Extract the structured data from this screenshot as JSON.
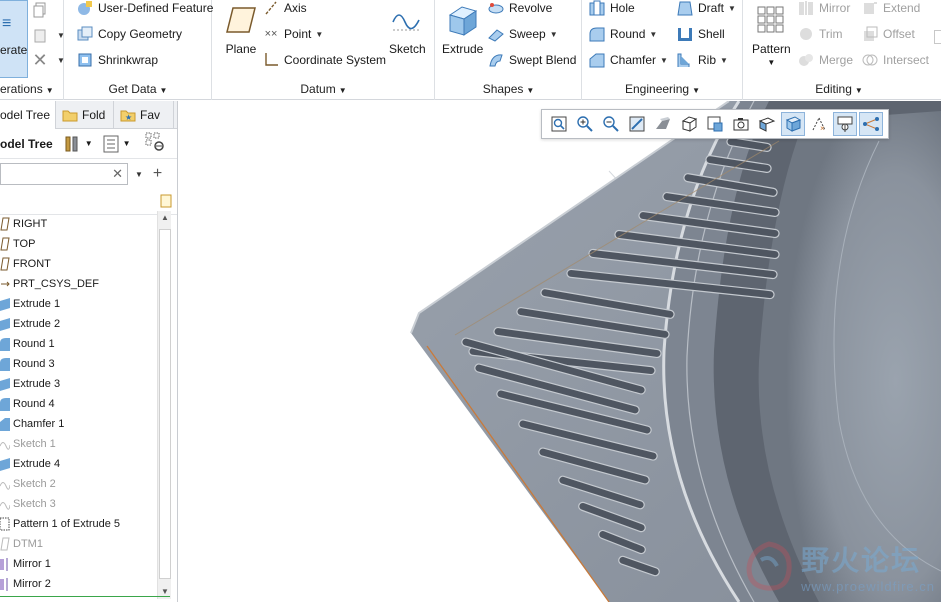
{
  "ribbon": {
    "operations": {
      "regenerate": "erate",
      "label": "erations"
    },
    "get_data": {
      "label": "Get Data",
      "items": [
        "User-Defined Feature",
        "Copy Geometry",
        "Shrinkwrap"
      ]
    },
    "datum": {
      "label": "Datum",
      "plane": "Plane",
      "axis": "Axis",
      "point": "Point",
      "csys": "Coordinate System",
      "sketch": "Sketch"
    },
    "shapes": {
      "label": "Shapes",
      "extrude": "Extrude",
      "revolve": "Revolve",
      "sweep": "Sweep",
      "swept_blend": "Swept Blend"
    },
    "engineering": {
      "label": "Engineering",
      "hole": "Hole",
      "round": "Round",
      "chamfer": "Chamfer",
      "draft": "Draft",
      "shell": "Shell",
      "rib": "Rib"
    },
    "editing": {
      "label": "Editing",
      "pattern": "Pattern",
      "mirror": "Mirror",
      "trim": "Trim",
      "merge": "Merge",
      "extend": "Extend",
      "offset": "Offset",
      "intersect": "Intersect"
    }
  },
  "panel": {
    "tabs": [
      "odel Tree",
      "Fold",
      "Fav"
    ],
    "title": "odel Tree",
    "search_placeholder": "",
    "items": [
      {
        "label": "RIGHT",
        "state": "normal"
      },
      {
        "label": "TOP",
        "state": "normal"
      },
      {
        "label": "FRONT",
        "state": "normal"
      },
      {
        "label": "PRT_CSYS_DEF",
        "state": "normal"
      },
      {
        "label": "Extrude 1",
        "state": "normal"
      },
      {
        "label": "Extrude 2",
        "state": "normal"
      },
      {
        "label": "Round 1",
        "state": "normal"
      },
      {
        "label": "Round 3",
        "state": "normal"
      },
      {
        "label": "Extrude 3",
        "state": "normal"
      },
      {
        "label": "Round 4",
        "state": "normal"
      },
      {
        "label": "Chamfer 1",
        "state": "normal"
      },
      {
        "label": "Sketch 1",
        "state": "suppressed"
      },
      {
        "label": "Extrude 4",
        "state": "normal"
      },
      {
        "label": "Sketch 2",
        "state": "suppressed"
      },
      {
        "label": "Sketch 3",
        "state": "suppressed"
      },
      {
        "label": "Pattern 1 of Extrude 5",
        "state": "normal"
      },
      {
        "label": "DTM1",
        "state": "suppressed"
      },
      {
        "label": "Mirror 1",
        "state": "normal"
      },
      {
        "label": "Mirror 2",
        "state": "normal"
      }
    ]
  },
  "watermark": {
    "text": "野火论坛",
    "url": "www.proewildfire.cn"
  },
  "colors": {
    "accent": "#2d7fc4",
    "part": "#8e96a3",
    "part_dark": "#5e6570",
    "edge": "#c97a3a"
  }
}
